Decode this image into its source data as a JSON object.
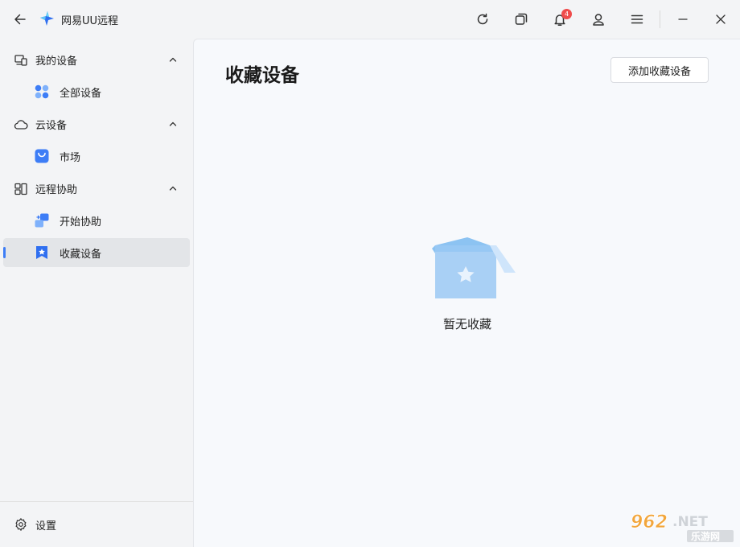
{
  "titlebar": {
    "title": "网易UU远程",
    "notification_count": "4",
    "icons": [
      "back-arrow-icon",
      "refresh-icon",
      "windows-icon",
      "bell-icon",
      "user-icon",
      "menu-icon",
      "minimize-icon",
      "close-icon"
    ]
  },
  "sidebar": {
    "groups": [
      {
        "label": "我的设备",
        "icon": "devices-icon",
        "expanded": true,
        "items": [
          {
            "label": "全部设备",
            "icon": "all-devices-icon"
          }
        ]
      },
      {
        "label": "云设备",
        "icon": "cloud-icon",
        "expanded": true,
        "items": [
          {
            "label": "市场",
            "icon": "market-bag-icon"
          }
        ]
      },
      {
        "label": "远程协助",
        "icon": "remote-assist-icon",
        "expanded": true,
        "items": [
          {
            "label": "开始协助",
            "icon": "start-assist-icon"
          },
          {
            "label": "收藏设备",
            "icon": "bookmark-star-icon",
            "active": true
          }
        ]
      }
    ],
    "settings_label": "设置"
  },
  "main": {
    "title": "收藏设备",
    "add_button": "添加收藏设备",
    "empty_text": "暂无收藏"
  },
  "watermark": {
    "brand": "962.NET",
    "subtitle": "乐游网"
  },
  "colors": {
    "accent": "#3d7df6",
    "badge": "#ef4b4b",
    "sidebar_bg": "#f3f4f6",
    "main_bg": "#f7f9fc",
    "active_bg": "#e3e5e8",
    "illustration": "#a9d0f5"
  }
}
